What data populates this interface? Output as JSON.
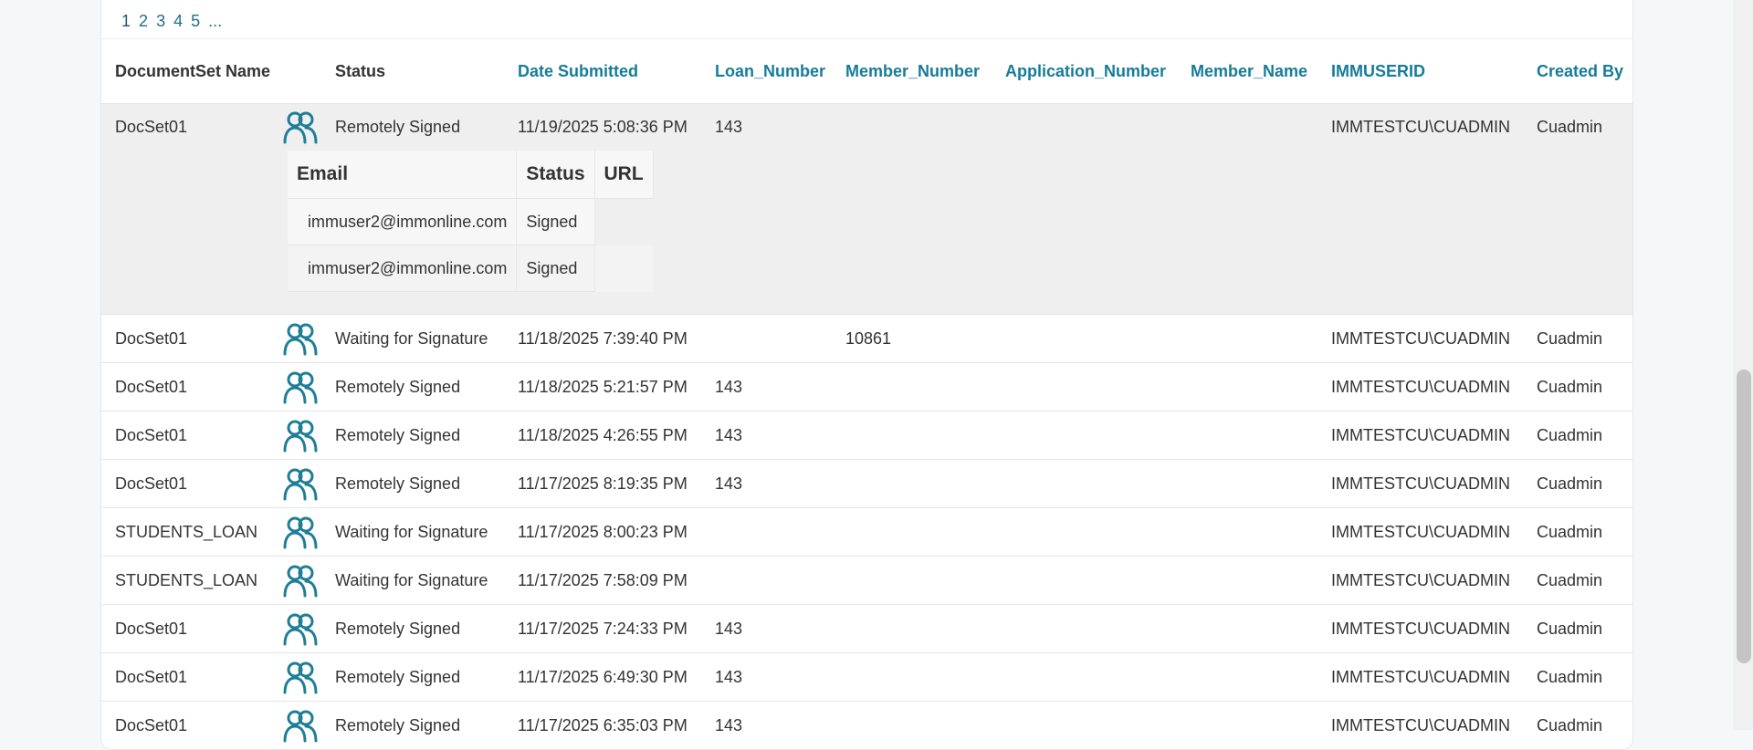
{
  "pager": {
    "pages": [
      "1",
      "2",
      "3",
      "4",
      "5",
      "..."
    ]
  },
  "colors": {
    "accent": "#167c99",
    "icon": "#1e7e97",
    "expanded_bg": "#efefef"
  },
  "columns": {
    "name": "DocumentSet Name",
    "status": "Status",
    "date": "Date Submitted",
    "loan": "Loan_Number",
    "member": "Member_Number",
    "app": "Application_Number",
    "mname": "Member_Name",
    "userid": "IMMUSERID",
    "created": "Created By"
  },
  "expanded": {
    "row": {
      "name": "DocSet01",
      "status": "Remotely Signed",
      "date": "11/19/2025 5:08:36 PM",
      "loan": "143",
      "member": "",
      "app": "",
      "mname": "",
      "userid": "IMMTESTCU\\CUADMIN",
      "created": "Cuadmin",
      "icon": "people-icon"
    },
    "signers_header": {
      "email": "Email",
      "status": "Status",
      "url": "URL"
    },
    "signers": [
      {
        "email": "immuser2@immonline.com",
        "status": "Signed",
        "url": ""
      },
      {
        "email": "immuser2@immonline.com",
        "status": "Signed",
        "url": ""
      }
    ]
  },
  "rows": [
    {
      "name": "DocSet01",
      "status": "Waiting for Signature",
      "date": "11/18/2025 7:39:40 PM",
      "loan": "",
      "member": "10861",
      "app": "",
      "mname": "",
      "userid": "IMMTESTCU\\CUADMIN",
      "created": "Cuadmin",
      "icon": "people-icon"
    },
    {
      "name": "DocSet01",
      "status": "Remotely Signed",
      "date": "11/18/2025 5:21:57 PM",
      "loan": "143",
      "member": "",
      "app": "",
      "mname": "",
      "userid": "IMMTESTCU\\CUADMIN",
      "created": "Cuadmin",
      "icon": "people-icon"
    },
    {
      "name": "DocSet01",
      "status": "Remotely Signed",
      "date": "11/18/2025 4:26:55 PM",
      "loan": "143",
      "member": "",
      "app": "",
      "mname": "",
      "userid": "IMMTESTCU\\CUADMIN",
      "created": "Cuadmin",
      "icon": "people-icon"
    },
    {
      "name": "DocSet01",
      "status": "Remotely Signed",
      "date": "11/17/2025 8:19:35 PM",
      "loan": "143",
      "member": "",
      "app": "",
      "mname": "",
      "userid": "IMMTESTCU\\CUADMIN",
      "created": "Cuadmin",
      "icon": "people-icon"
    },
    {
      "name": "STUDENTS_LOAN",
      "status": "Waiting for Signature",
      "date": "11/17/2025 8:00:23 PM",
      "loan": "",
      "member": "",
      "app": "",
      "mname": "",
      "userid": "IMMTESTCU\\CUADMIN",
      "created": "Cuadmin",
      "icon": "people-icon"
    },
    {
      "name": "STUDENTS_LOAN",
      "status": "Waiting for Signature",
      "date": "11/17/2025 7:58:09 PM",
      "loan": "",
      "member": "",
      "app": "",
      "mname": "",
      "userid": "IMMTESTCU\\CUADMIN",
      "created": "Cuadmin",
      "icon": "people-icon"
    },
    {
      "name": "DocSet01",
      "status": "Remotely Signed",
      "date": "11/17/2025 7:24:33 PM",
      "loan": "143",
      "member": "",
      "app": "",
      "mname": "",
      "userid": "IMMTESTCU\\CUADMIN",
      "created": "Cuadmin",
      "icon": "people-icon"
    },
    {
      "name": "DocSet01",
      "status": "Remotely Signed",
      "date": "11/17/2025 6:49:30 PM",
      "loan": "143",
      "member": "",
      "app": "",
      "mname": "",
      "userid": "IMMTESTCU\\CUADMIN",
      "created": "Cuadmin",
      "icon": "people-icon"
    },
    {
      "name": "DocSet01",
      "status": "Remotely Signed",
      "date": "11/17/2025 6:35:03 PM",
      "loan": "143",
      "member": "",
      "app": "",
      "mname": "",
      "userid": "IMMTESTCU\\CUADMIN",
      "created": "Cuadmin",
      "icon": "people-icon"
    }
  ]
}
